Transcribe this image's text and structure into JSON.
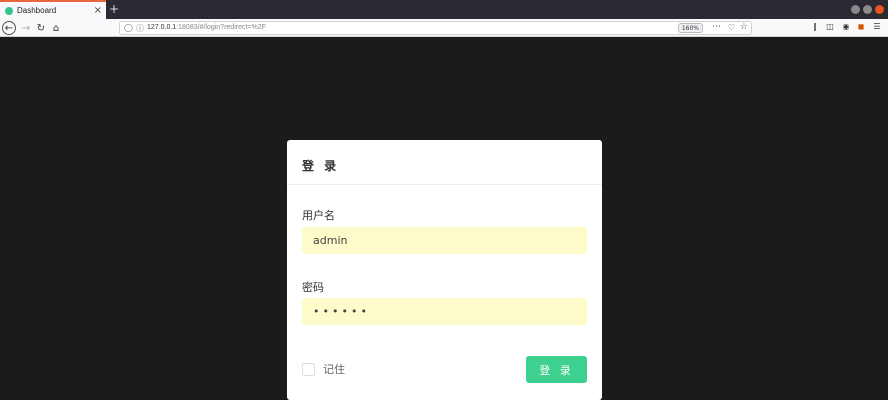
{
  "browser": {
    "tab_title": "Dashboard",
    "tab_close": "×",
    "new_tab": "+",
    "url_host": "127.0.0.1",
    "url_rest": ":18083/#/login?redirect=%2F",
    "zoom": "160%",
    "icons": [
      "back-icon",
      "forward-icon",
      "reload-icon",
      "home-icon",
      "shield-icon",
      "info-icon",
      "more-icon",
      "pocket-icon",
      "star-icon",
      "library-icon",
      "sidebar-icon",
      "account-icon",
      "extension-icon",
      "menu-icon"
    ]
  },
  "login": {
    "title": "登 录",
    "username_label": "用户名",
    "username_value": "admin",
    "password_label": "密码",
    "password_value": "••••••",
    "remember_label": "记住",
    "submit_label": "登 录"
  },
  "colors": {
    "page_bg": "#1c1b1b",
    "input_bg": "#fefbca",
    "button": "#3ed08f",
    "tab_accent": "#e8663b"
  }
}
